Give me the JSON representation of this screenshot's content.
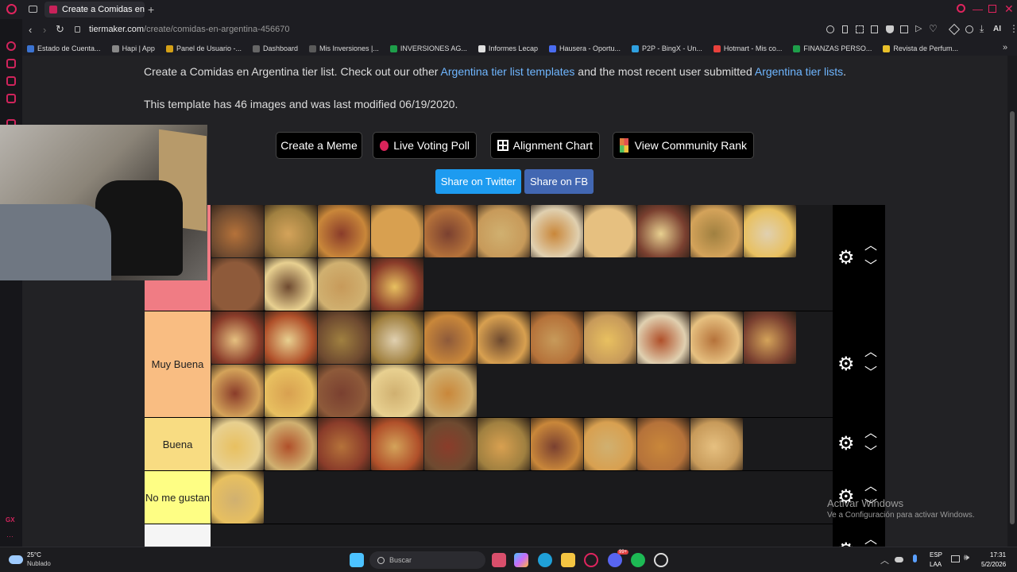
{
  "browser": {
    "tab_title": "Create a Comidas en Argen",
    "url_host": "tiermaker.com",
    "url_path": "/create/comidas-en-argentina-456670",
    "bookmarks": [
      "Estado de Cuenta...",
      "Hapi | App",
      "Panel de Usuario -...",
      "Dashboard",
      "Mis Inversiones |...",
      "INVERSIONES AG...",
      "Informes Lecap",
      "Hausera - Oportu...",
      "P2P - BingX - Un...",
      "Hotmart - Mis co...",
      "FINANZAS PERSO...",
      "Revista de Perfum..."
    ],
    "bookmark_colors": [
      "#3b73d1",
      "#888888",
      "#d4a017",
      "#666666",
      "#5a5a5a",
      "#1e9e4a",
      "#e0e0e0",
      "#4a6cf0",
      "#2fa0e0",
      "#e8413c",
      "#1e9e4a",
      "#e8c02a"
    ],
    "ai_label": "AI"
  },
  "intro": {
    "line1_prefix": "Create a Comidas en Argentina tier list. Check out our other ",
    "link1": "Argentina tier list templates",
    "line1_mid": " and the most recent user submitted ",
    "link2": "Argentina tier lists",
    "line1_suffix": ".",
    "line2": "This template has 46 images and was last modified 06/19/2020."
  },
  "buttons": {
    "meme": "Create a Meme",
    "poll": "Live Voting Poll",
    "alignment": "Alignment Chart",
    "community": "View Community Rank",
    "twitter": "Share on Twitter",
    "fb": "Share on FB"
  },
  "tiers": [
    {
      "label": "",
      "color": "#f07c84",
      "images": 15
    },
    {
      "label": "Muy Buena",
      "color": "#f9bd82",
      "images": 16
    },
    {
      "label": "Buena",
      "color": "#f8dc82",
      "images": 10
    },
    {
      "label": "No me gustan",
      "color": "#fefe84",
      "images": 1
    },
    {
      "label": "",
      "color": "#f5f5f5",
      "images": 0
    }
  ],
  "watermark": {
    "title": "Activar Windows",
    "subtitle": "Ve a Configuración para activar Windows."
  },
  "taskbar": {
    "temp": "25°C",
    "weather": "Nublado",
    "search": "Buscar",
    "lang": "ESP",
    "layout": "LAA",
    "time": "17:31",
    "date": "5/2/2026",
    "badge": "99+"
  }
}
